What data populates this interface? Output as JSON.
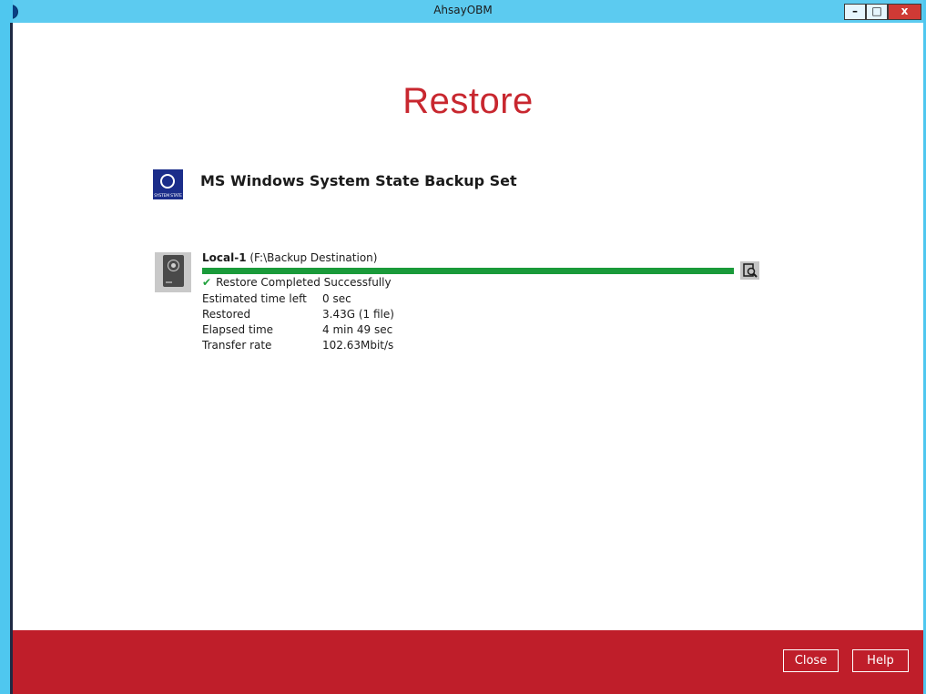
{
  "window": {
    "title": "AhsayOBM",
    "minimize": "–",
    "maximize": "□",
    "close": "x"
  },
  "page": {
    "title": "Restore"
  },
  "backup_set": {
    "name": "MS Windows System State Backup Set",
    "icon_label": "SYSTEM STATE",
    "icon": "windows-system-state-icon"
  },
  "destination": {
    "name": "Local-1",
    "path": "(F:\\Backup Destination)",
    "icon": "hard-disk-icon",
    "progress": 1.0,
    "status": "Restore Completed Successfully",
    "status_icon": "✔",
    "stats": [
      {
        "label": "Estimated time left",
        "value": "0 sec"
      },
      {
        "label": "Restored",
        "value": "3.43G (1 file)"
      },
      {
        "label": "Elapsed time",
        "value": "4 min 49 sec"
      },
      {
        "label": "Transfer rate",
        "value": "102.63Mbit/s"
      }
    ]
  },
  "footer": {
    "close_label": "Close",
    "help_label": "Help"
  },
  "colors": {
    "accent_red": "#bf1e2a",
    "title_red": "#c8272f",
    "progress_green": "#1fa03b",
    "titlebar_blue": "#5ccbf0"
  }
}
